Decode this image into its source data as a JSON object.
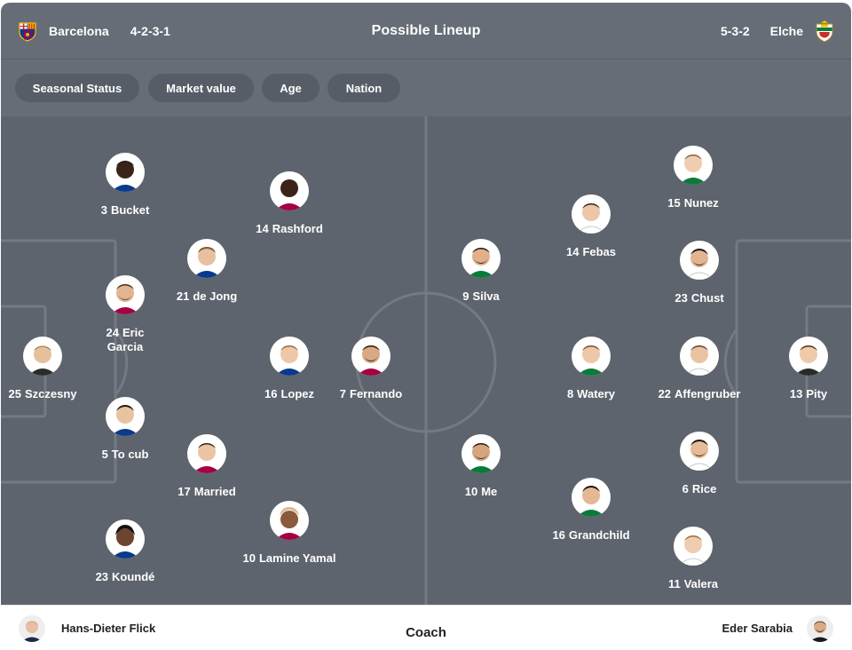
{
  "header": {
    "title": "Possible Lineup",
    "home": {
      "name": "Barcelona",
      "formation": "4-2-3-1",
      "crest_icon": "barcelona-crest-icon",
      "color": "#a50044"
    },
    "away": {
      "name": "Elche",
      "formation": "5-3-2",
      "crest_icon": "elche-crest-icon",
      "color": "#0b7a3b"
    }
  },
  "filters": [
    "Seasonal Status",
    "Market value",
    "Age",
    "Nation"
  ],
  "home_players": [
    {
      "number": "3",
      "name": "Bucket"
    },
    {
      "number": "14",
      "name": "Rashford"
    },
    {
      "number": "21",
      "name": "de Jong"
    },
    {
      "number": "24",
      "name": "Eric Garcia"
    },
    {
      "number": "25",
      "name": "Szczesny"
    },
    {
      "number": "16",
      "name": "Lopez"
    },
    {
      "number": "7",
      "name": "Fernando"
    },
    {
      "number": "5",
      "name": "To cub"
    },
    {
      "number": "17",
      "name": "Married"
    },
    {
      "number": "23",
      "name": "Koundé"
    },
    {
      "number": "10",
      "name": "Lamine Yamal"
    }
  ],
  "away_players": [
    {
      "number": "15",
      "name": "Nunez"
    },
    {
      "number": "14",
      "name": "Febas"
    },
    {
      "number": "9",
      "name": "Silva"
    },
    {
      "number": "23",
      "name": "Chust"
    },
    {
      "number": "8",
      "name": "Watery"
    },
    {
      "number": "22",
      "name": "Affengruber"
    },
    {
      "number": "13",
      "name": "Pity"
    },
    {
      "number": "10",
      "name": "Me"
    },
    {
      "number": "6",
      "name": "Rice"
    },
    {
      "number": "16",
      "name": "Grandchild"
    },
    {
      "number": "11",
      "name": "Valera"
    }
  ],
  "coaches": {
    "label": "Coach",
    "home": "Hans-Dieter Flick",
    "away": "Eder Sarabia"
  },
  "colors": {
    "pitch": "#5e646d",
    "header": "#666d76",
    "lines": "#737a83"
  }
}
